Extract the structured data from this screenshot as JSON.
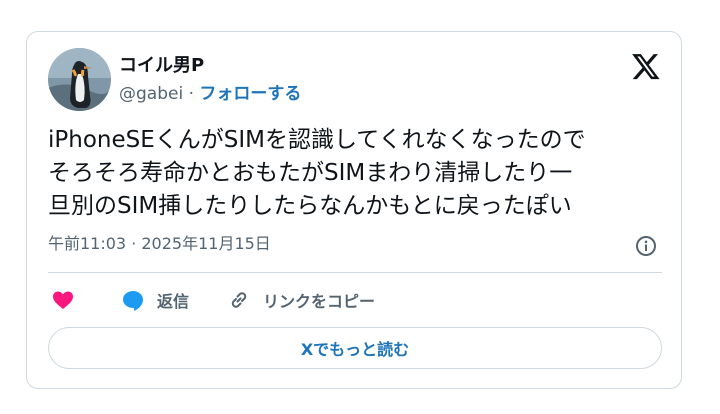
{
  "author": {
    "display_name": "コイル男P",
    "handle": "@gabei",
    "separator": "·",
    "follow_label": "フォローする",
    "avatar_icon": "penguin-avatar"
  },
  "tweet": {
    "lines": [
      "iPhoneSEくんがSIMを認識してくれなくなったので",
      "そろそろ寿命かとおもたがSIMまわり清掃したり一",
      "旦別のSIM挿したりしたらなんかもとに戻ったぽい"
    ],
    "timestamp": "午前11:03 · 2025年11月15日"
  },
  "actions": {
    "like_icon": "heart-icon",
    "reply_label": "返信",
    "copy_link_label": "リンクをコピー"
  },
  "read_more_label": "Xでもっと読む",
  "colors": {
    "accent": "#1d74b8",
    "like": "#f91880",
    "reply_bubble": "#1d9bf0",
    "border": "#cfd9de",
    "secondary_text": "#536471"
  }
}
